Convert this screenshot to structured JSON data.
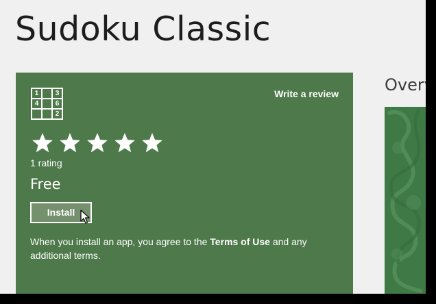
{
  "app": {
    "title": "Sudoku Classic"
  },
  "icon": {
    "name": "sudoku-grid-icon",
    "cells": [
      "1",
      "",
      "3",
      "4",
      "",
      "6",
      "",
      "",
      "2"
    ]
  },
  "panel": {
    "write_review_label": "Write a review",
    "rating": {
      "stars": 5,
      "max": 5,
      "count_label": "1 rating"
    },
    "price": "Free",
    "install_label": "Install",
    "terms": {
      "prefix": "When you install an app, you agree to the ",
      "link": "Terms of Use",
      "suffix": " and any additional terms."
    }
  },
  "overview": {
    "heading": "Overv"
  },
  "colors": {
    "panel_bg": "#4e794a",
    "page_bg": "#f0f0f0",
    "overview_image": "#3f7a46"
  }
}
